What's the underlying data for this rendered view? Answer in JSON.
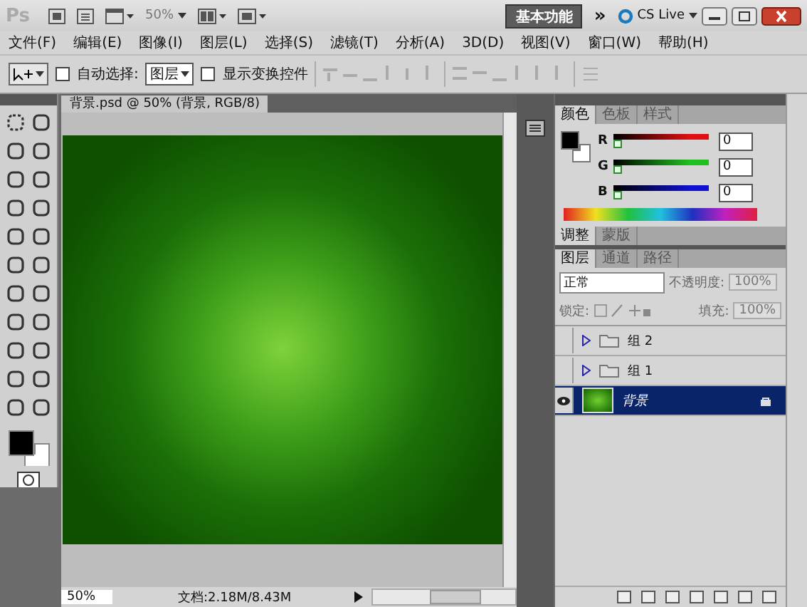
{
  "app_bar": {
    "logo": "Ps",
    "zoom": "50%",
    "workspace": "基本功能",
    "more": "»",
    "cs_live": "CS Live"
  },
  "menu": [
    "文件(F)",
    "编辑(E)",
    "图像(I)",
    "图层(L)",
    "选择(S)",
    "滤镜(T)",
    "分析(A)",
    "3D(D)",
    "视图(V)",
    "窗口(W)",
    "帮助(H)"
  ],
  "options_bar": {
    "auto_select": {
      "label": "自动选择:",
      "checked": false
    },
    "target": "图层",
    "transform": {
      "label": "显示变换控件",
      "checked": false
    }
  },
  "document": {
    "tab": "背景.psd @ 50% (背景, RGB/8)",
    "zoom": "50%",
    "doc_info": "文档:2.18M/8.43M"
  },
  "color_panel": {
    "tabs": [
      {
        "label": "颜色",
        "selected": true
      },
      {
        "label": "色板",
        "selected": false
      },
      {
        "label": "样式",
        "selected": false
      }
    ],
    "channels": [
      {
        "label": "R",
        "value": "0",
        "level": 0,
        "color": "#e01010"
      },
      {
        "label": "G",
        "value": "0",
        "level": 0,
        "color": "#20c020"
      },
      {
        "label": "B",
        "value": "0",
        "level": 0,
        "color": "#1010d0"
      }
    ]
  },
  "adjust_tabs": [
    {
      "label": "调整",
      "selected": true
    },
    {
      "label": "蒙版",
      "selected": false
    }
  ],
  "layers_panel": {
    "tabs": [
      {
        "label": "图层",
        "selected": true
      },
      {
        "label": "通道",
        "selected": false
      },
      {
        "label": "路径",
        "selected": false
      }
    ],
    "blend": "正常",
    "opacity_label": "不透明度:",
    "opacity": "100%",
    "lock_label": "锁定:",
    "fill_label": "填充:",
    "fill": "100%",
    "layers": [
      {
        "name": "组 2",
        "kind": "group",
        "visible": false,
        "selected": false
      },
      {
        "name": "组 1",
        "kind": "group",
        "visible": false,
        "selected": false
      },
      {
        "name": "背景",
        "kind": "image",
        "visible": true,
        "selected": true
      }
    ]
  }
}
